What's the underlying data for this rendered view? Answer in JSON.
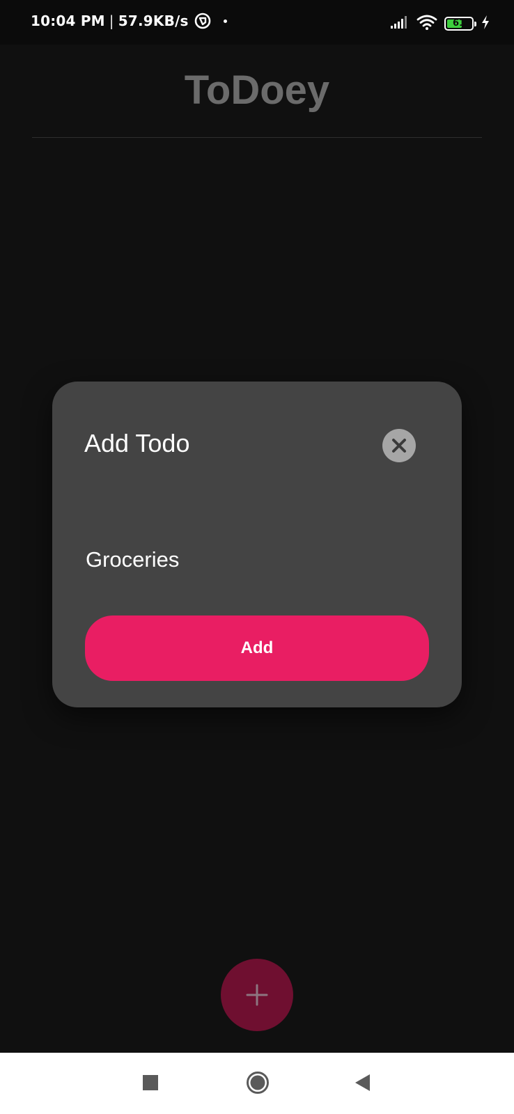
{
  "status_bar": {
    "time": "10:04 PM",
    "separator": "|",
    "network_speed": "57.9KB/s",
    "battery_level": "61",
    "battery_fraction": 0.61,
    "icons": [
      "app-notification-icon",
      "signal-icon",
      "wifi-icon",
      "battery-icon",
      "charging-icon"
    ]
  },
  "app": {
    "title": "ToDoey"
  },
  "dialog": {
    "title": "Add Todo",
    "input_value": "Groceries",
    "add_label": "Add",
    "close_icon": "close-icon"
  },
  "fab": {
    "icon": "plus-icon"
  },
  "nav_bar": {
    "icons": [
      "recents-icon",
      "home-icon",
      "back-icon"
    ]
  },
  "colors": {
    "background": "#101010",
    "dialog": "#444444",
    "accent": "#e91e63",
    "fab_dimmed": "#6f0f30",
    "title_text": "#6b6b6b"
  }
}
